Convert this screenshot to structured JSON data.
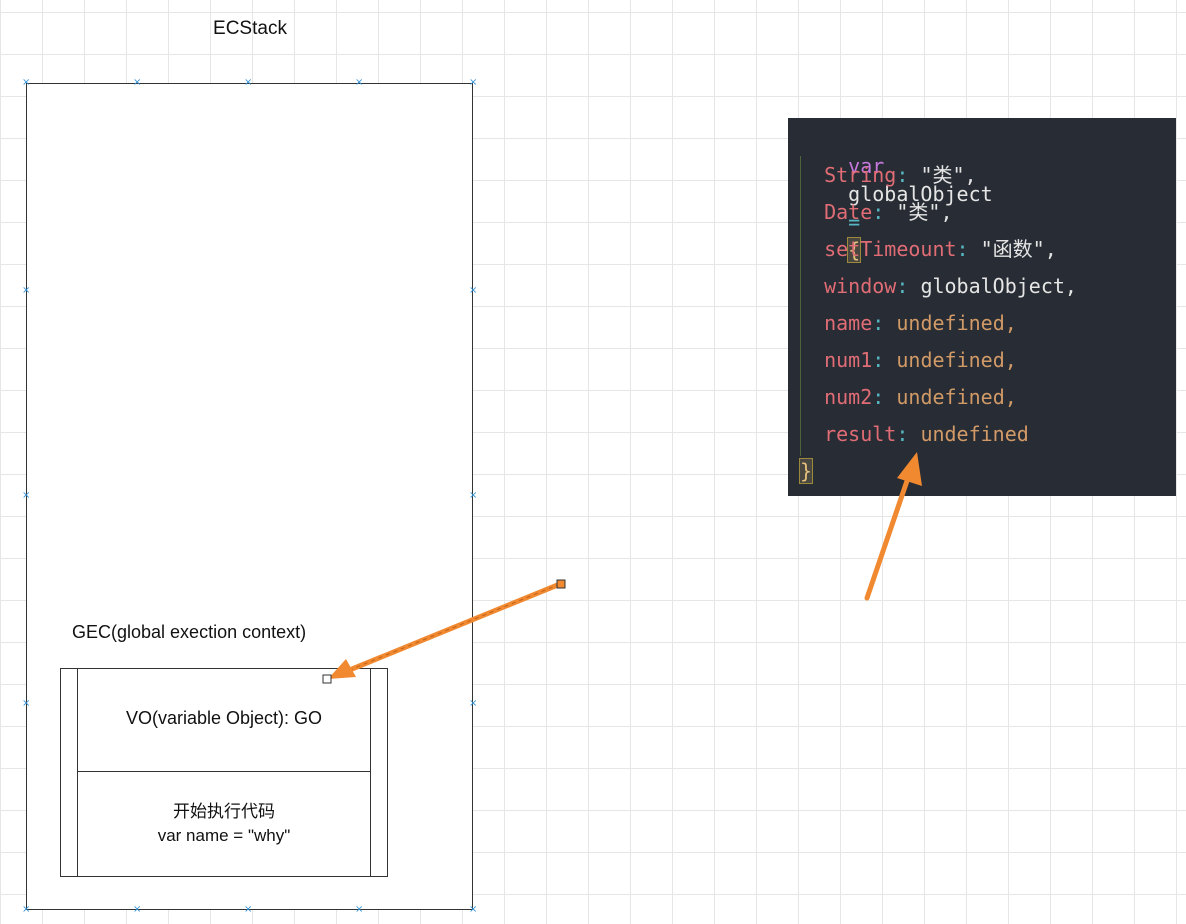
{
  "diagram": {
    "stack_title": "ECStack",
    "gec_label": "GEC(global exection context)",
    "vo_text": "VO(variable Object): GO",
    "exec_line1": "开始执行代码",
    "exec_line2": "var name = \"why\""
  },
  "code": {
    "line1": {
      "kw": "var",
      "ident": "globalObject",
      "eq": "=",
      "brace": "{"
    },
    "props": [
      {
        "key": "String",
        "sep": ":",
        "value": "\"类\",",
        "value_kind": "str"
      },
      {
        "key": "Date",
        "sep": ":",
        "value": "\"类\",",
        "value_kind": "str"
      },
      {
        "key": "setTimeount",
        "sep": ":",
        "value": "\"函数\",",
        "value_kind": "str"
      },
      {
        "key": "window",
        "sep": ":",
        "value": "globalObject,",
        "value_kind": "id"
      },
      {
        "key": "name",
        "sep": ":",
        "value": "undefined,",
        "value_kind": "val"
      },
      {
        "key": "num1",
        "sep": ":",
        "value": "undefined,",
        "value_kind": "val"
      },
      {
        "key": "num2",
        "sep": ":",
        "value": "undefined,",
        "value_kind": "val"
      },
      {
        "key": "result",
        "sep": ":",
        "value": "undefined",
        "value_kind": "val"
      }
    ],
    "closing": "}"
  },
  "colors": {
    "arrow": "#f0892f",
    "handle": "#2b8fd6",
    "code_bg": "#282c34",
    "keyword": "#c678dd",
    "property": "#e06c75",
    "undefined": "#d19a66",
    "brace": "#e5c07b"
  }
}
